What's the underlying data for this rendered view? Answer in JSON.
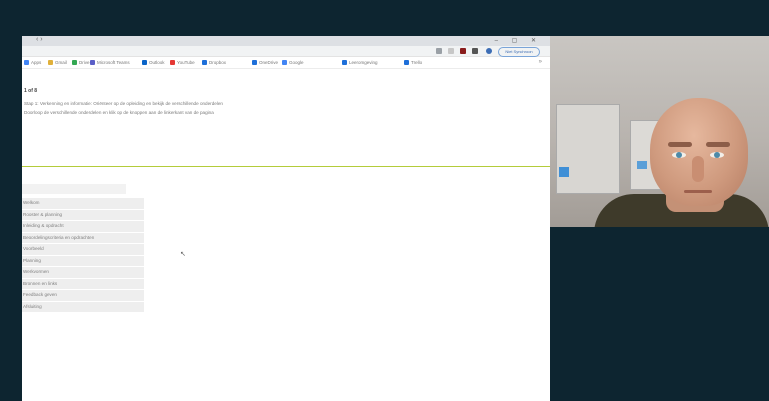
{
  "browser": {
    "profile_label": "Niet Synchroon",
    "tab_arrows": "‹ ›",
    "window_controls": "– ▢ ✕"
  },
  "bookmarks": [
    {
      "label": "Apps",
      "color": "#4285f4"
    },
    {
      "label": "Gmail",
      "color": "#e0b03a"
    },
    {
      "label": "Drive",
      "color": "#34a853"
    },
    {
      "label": "Microsoft Teams",
      "color": "#5b5fc7"
    },
    {
      "label": "Outlook",
      "color": "#0a64c8"
    },
    {
      "label": "YouTube",
      "color": "#e53935"
    },
    {
      "label": "Dropbox",
      "color": "#1e6fd9"
    },
    {
      "label": "OneDrive",
      "color": "#1e6fd9"
    },
    {
      "label": "Google",
      "color": "#4285f4"
    },
    {
      "label": "Leeromgeving",
      "color": "#1e6fd9"
    },
    {
      "label": "Trello",
      "color": "#1e6fd9"
    }
  ],
  "page": {
    "title": "1 of 8",
    "desc_line1": "Stap 1: Verkenning en informatie: Oriënteer op de opleiding en bekijk de verschillende onderdelen",
    "desc_line2": "Doorloop de verschillende onderdelen en klik op de knoppen aan de linkerkant van de pagina"
  },
  "menu": {
    "items": [
      "Welkom",
      "Rooster & planning",
      "Inleiding & opdracht",
      "Beoordelingscriteria en opdrachten",
      "Voorbeeld",
      "Planning",
      "Werkvormen",
      "Bronnen en links",
      "Feedback geven",
      "Afsluiting"
    ]
  },
  "cursor_glyph": "↖"
}
